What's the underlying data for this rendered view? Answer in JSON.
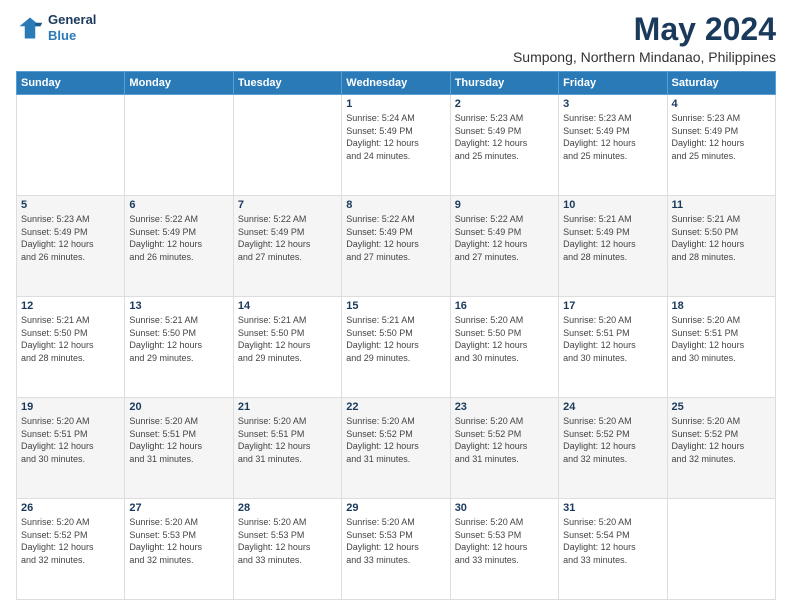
{
  "logo": {
    "line1": "General",
    "line2": "Blue"
  },
  "title": "May 2024",
  "subtitle": "Sumpong, Northern Mindanao, Philippines",
  "days_header": [
    "Sunday",
    "Monday",
    "Tuesday",
    "Wednesday",
    "Thursday",
    "Friday",
    "Saturday"
  ],
  "weeks": [
    [
      {
        "day": "",
        "info": ""
      },
      {
        "day": "",
        "info": ""
      },
      {
        "day": "",
        "info": ""
      },
      {
        "day": "1",
        "info": "Sunrise: 5:24 AM\nSunset: 5:49 PM\nDaylight: 12 hours\nand 24 minutes."
      },
      {
        "day": "2",
        "info": "Sunrise: 5:23 AM\nSunset: 5:49 PM\nDaylight: 12 hours\nand 25 minutes."
      },
      {
        "day": "3",
        "info": "Sunrise: 5:23 AM\nSunset: 5:49 PM\nDaylight: 12 hours\nand 25 minutes."
      },
      {
        "day": "4",
        "info": "Sunrise: 5:23 AM\nSunset: 5:49 PM\nDaylight: 12 hours\nand 25 minutes."
      }
    ],
    [
      {
        "day": "5",
        "info": "Sunrise: 5:23 AM\nSunset: 5:49 PM\nDaylight: 12 hours\nand 26 minutes."
      },
      {
        "day": "6",
        "info": "Sunrise: 5:22 AM\nSunset: 5:49 PM\nDaylight: 12 hours\nand 26 minutes."
      },
      {
        "day": "7",
        "info": "Sunrise: 5:22 AM\nSunset: 5:49 PM\nDaylight: 12 hours\nand 27 minutes."
      },
      {
        "day": "8",
        "info": "Sunrise: 5:22 AM\nSunset: 5:49 PM\nDaylight: 12 hours\nand 27 minutes."
      },
      {
        "day": "9",
        "info": "Sunrise: 5:22 AM\nSunset: 5:49 PM\nDaylight: 12 hours\nand 27 minutes."
      },
      {
        "day": "10",
        "info": "Sunrise: 5:21 AM\nSunset: 5:49 PM\nDaylight: 12 hours\nand 28 minutes."
      },
      {
        "day": "11",
        "info": "Sunrise: 5:21 AM\nSunset: 5:50 PM\nDaylight: 12 hours\nand 28 minutes."
      }
    ],
    [
      {
        "day": "12",
        "info": "Sunrise: 5:21 AM\nSunset: 5:50 PM\nDaylight: 12 hours\nand 28 minutes."
      },
      {
        "day": "13",
        "info": "Sunrise: 5:21 AM\nSunset: 5:50 PM\nDaylight: 12 hours\nand 29 minutes."
      },
      {
        "day": "14",
        "info": "Sunrise: 5:21 AM\nSunset: 5:50 PM\nDaylight: 12 hours\nand 29 minutes."
      },
      {
        "day": "15",
        "info": "Sunrise: 5:21 AM\nSunset: 5:50 PM\nDaylight: 12 hours\nand 29 minutes."
      },
      {
        "day": "16",
        "info": "Sunrise: 5:20 AM\nSunset: 5:50 PM\nDaylight: 12 hours\nand 30 minutes."
      },
      {
        "day": "17",
        "info": "Sunrise: 5:20 AM\nSunset: 5:51 PM\nDaylight: 12 hours\nand 30 minutes."
      },
      {
        "day": "18",
        "info": "Sunrise: 5:20 AM\nSunset: 5:51 PM\nDaylight: 12 hours\nand 30 minutes."
      }
    ],
    [
      {
        "day": "19",
        "info": "Sunrise: 5:20 AM\nSunset: 5:51 PM\nDaylight: 12 hours\nand 30 minutes."
      },
      {
        "day": "20",
        "info": "Sunrise: 5:20 AM\nSunset: 5:51 PM\nDaylight: 12 hours\nand 31 minutes."
      },
      {
        "day": "21",
        "info": "Sunrise: 5:20 AM\nSunset: 5:51 PM\nDaylight: 12 hours\nand 31 minutes."
      },
      {
        "day": "22",
        "info": "Sunrise: 5:20 AM\nSunset: 5:52 PM\nDaylight: 12 hours\nand 31 minutes."
      },
      {
        "day": "23",
        "info": "Sunrise: 5:20 AM\nSunset: 5:52 PM\nDaylight: 12 hours\nand 31 minutes."
      },
      {
        "day": "24",
        "info": "Sunrise: 5:20 AM\nSunset: 5:52 PM\nDaylight: 12 hours\nand 32 minutes."
      },
      {
        "day": "25",
        "info": "Sunrise: 5:20 AM\nSunset: 5:52 PM\nDaylight: 12 hours\nand 32 minutes."
      }
    ],
    [
      {
        "day": "26",
        "info": "Sunrise: 5:20 AM\nSunset: 5:52 PM\nDaylight: 12 hours\nand 32 minutes."
      },
      {
        "day": "27",
        "info": "Sunrise: 5:20 AM\nSunset: 5:53 PM\nDaylight: 12 hours\nand 32 minutes."
      },
      {
        "day": "28",
        "info": "Sunrise: 5:20 AM\nSunset: 5:53 PM\nDaylight: 12 hours\nand 33 minutes."
      },
      {
        "day": "29",
        "info": "Sunrise: 5:20 AM\nSunset: 5:53 PM\nDaylight: 12 hours\nand 33 minutes."
      },
      {
        "day": "30",
        "info": "Sunrise: 5:20 AM\nSunset: 5:53 PM\nDaylight: 12 hours\nand 33 minutes."
      },
      {
        "day": "31",
        "info": "Sunrise: 5:20 AM\nSunset: 5:54 PM\nDaylight: 12 hours\nand 33 minutes."
      },
      {
        "day": "",
        "info": ""
      }
    ]
  ]
}
